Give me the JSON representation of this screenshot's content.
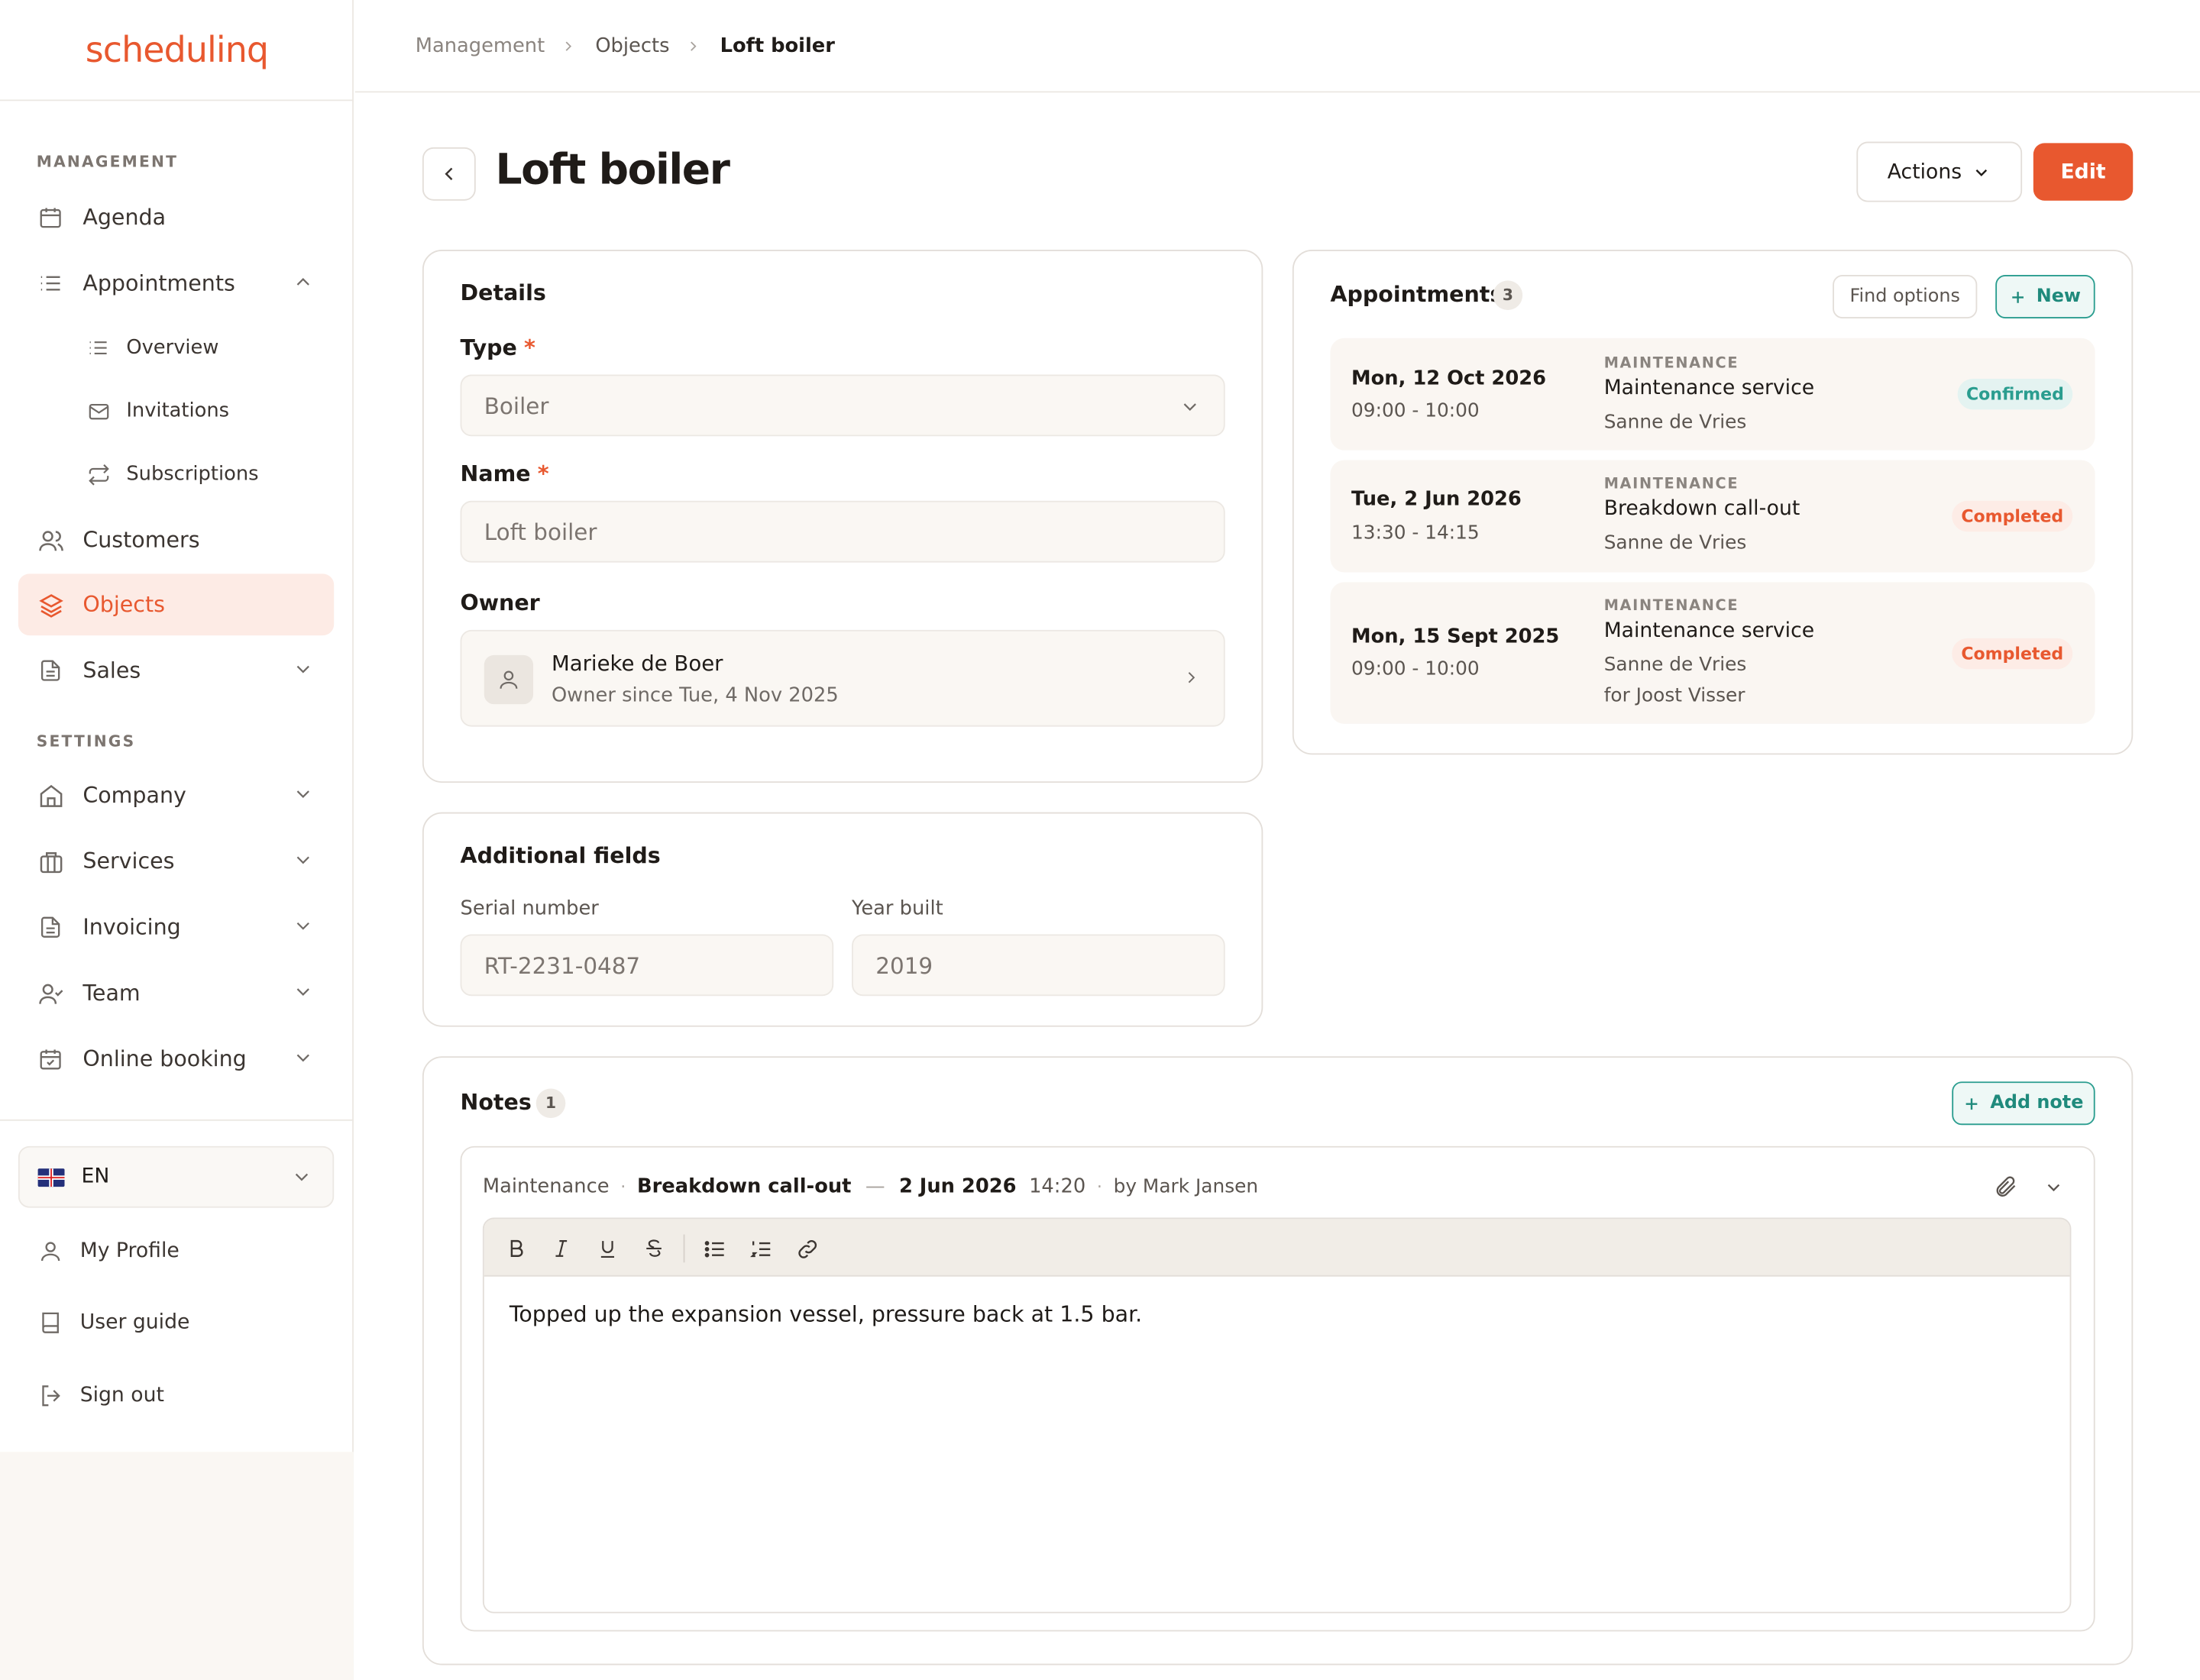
{
  "app": {
    "logo": "schedulinq",
    "brand_color": "#e8582f",
    "accent_color": "#2a9d8f"
  },
  "sidebar": {
    "management_label": "MANAGEMENT",
    "settings_label": "SETTINGS",
    "items": {
      "agenda": {
        "label": "Agenda",
        "icon": "calendar-icon"
      },
      "appointments": {
        "label": "Appointments",
        "icon": "list-icon",
        "expanded": true
      },
      "overview": {
        "label": "Overview",
        "icon": "list-icon"
      },
      "invitations": {
        "label": "Invitations",
        "icon": "mail-icon"
      },
      "subscriptions": {
        "label": "Subscriptions",
        "icon": "repeat-icon"
      },
      "customers": {
        "label": "Customers",
        "icon": "users-icon"
      },
      "objects": {
        "label": "Objects",
        "icon": "layers-icon",
        "active": true
      },
      "sales": {
        "label": "Sales",
        "icon": "file-icon"
      },
      "company": {
        "label": "Company",
        "icon": "home-icon"
      },
      "services": {
        "label": "Services",
        "icon": "briefcase-icon"
      },
      "invoicing": {
        "label": "Invoicing",
        "icon": "file-icon"
      },
      "team": {
        "label": "Team",
        "icon": "user-check-icon"
      },
      "online_booking": {
        "label": "Online booking",
        "icon": "calendar-check-icon"
      }
    },
    "language": {
      "code": "EN",
      "icon": "uk-flag-icon"
    },
    "footer": {
      "profile": "My Profile",
      "guide": "User guide",
      "signout": "Sign out"
    }
  },
  "breadcrumb": [
    "Management",
    "Objects",
    "Loft boiler"
  ],
  "header": {
    "title": "Loft boiler",
    "actions_label": "Actions",
    "edit_label": "Edit"
  },
  "details": {
    "title": "Details",
    "type_label": "Type",
    "type_value": "Boiler",
    "name_label": "Name",
    "name_value": "Loft boiler",
    "owner_label": "Owner",
    "owner_name": "Marieke de Boer",
    "owner_since": "Owner since Tue, 4 Nov 2025",
    "required_mark": "*"
  },
  "additional": {
    "title": "Additional fields",
    "serial_label": "Serial number",
    "serial_value": "RT-2231-0487",
    "year_label": "Year built",
    "year_value": "2019"
  },
  "appointments": {
    "title": "Appointments",
    "count": "3",
    "find_label": "Find options",
    "new_label": "New",
    "items": [
      {
        "date": "Mon, 12 Oct 2026",
        "time": "09:00 - 10:00",
        "category": "MAINTENANCE",
        "service": "Maintenance service",
        "staff": "Sanne de Vries",
        "extra": "",
        "status": "Confirmed"
      },
      {
        "date": "Tue, 2 Jun 2026",
        "time": "13:30 - 14:15",
        "category": "MAINTENANCE",
        "service": "Breakdown call-out",
        "staff": "Sanne de Vries",
        "extra": "",
        "status": "Completed"
      },
      {
        "date": "Mon, 15 Sept 2025",
        "time": "09:00 - 10:00",
        "category": "MAINTENANCE",
        "service": "Maintenance service",
        "staff": "Sanne de Vries",
        "extra": "for Joost Visser",
        "status": "Completed"
      }
    ]
  },
  "notes": {
    "title": "Notes",
    "count": "1",
    "add_label": "Add note",
    "items": [
      {
        "category": "Maintenance",
        "service": "Breakdown call-out",
        "date": "2 Jun 2026",
        "time": "14:20",
        "author": "by Mark Jansen",
        "text": "Topped up the expansion vessel, pressure back at 1.5 bar."
      }
    ]
  }
}
